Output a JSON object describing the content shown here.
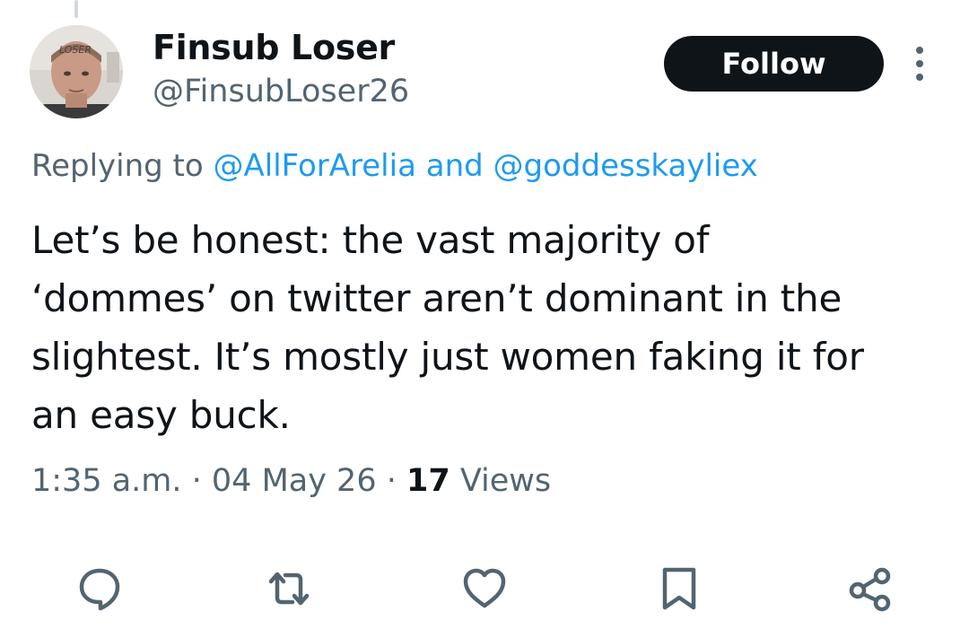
{
  "author": {
    "display_name": "Finsub Loser",
    "handle": "@FinsubLoser26",
    "avatar_text": "LOSER"
  },
  "follow_button": {
    "label": "Follow"
  },
  "reply_context": {
    "prefix": "Replying to ",
    "mention_1": "@AllForArelia",
    "joiner": " and ",
    "mention_2": "@goddesskayliex"
  },
  "body": "Let’s be honest: the vast majority of\n‘dommes’ on twitter aren’t dominant in the\nslightest. It’s mostly just women faking it for\nan easy buck.",
  "meta": {
    "time": "1:35 a.m.",
    "separator_1": " · ",
    "date": "04 May 26",
    "separator_2": " · ",
    "views_count": "17",
    "views_label": " Views"
  },
  "actions": [
    {
      "name": "reply",
      "icon": "reply-icon"
    },
    {
      "name": "retweet",
      "icon": "retweet-icon"
    },
    {
      "name": "like",
      "icon": "heart-icon"
    },
    {
      "name": "bookmark",
      "icon": "bookmark-icon"
    },
    {
      "name": "share",
      "icon": "share-icon"
    }
  ],
  "colors": {
    "text": "#0f1419",
    "secondary": "#536471",
    "accent": "#1d9bf0",
    "follow_bg": "#0f1419"
  }
}
